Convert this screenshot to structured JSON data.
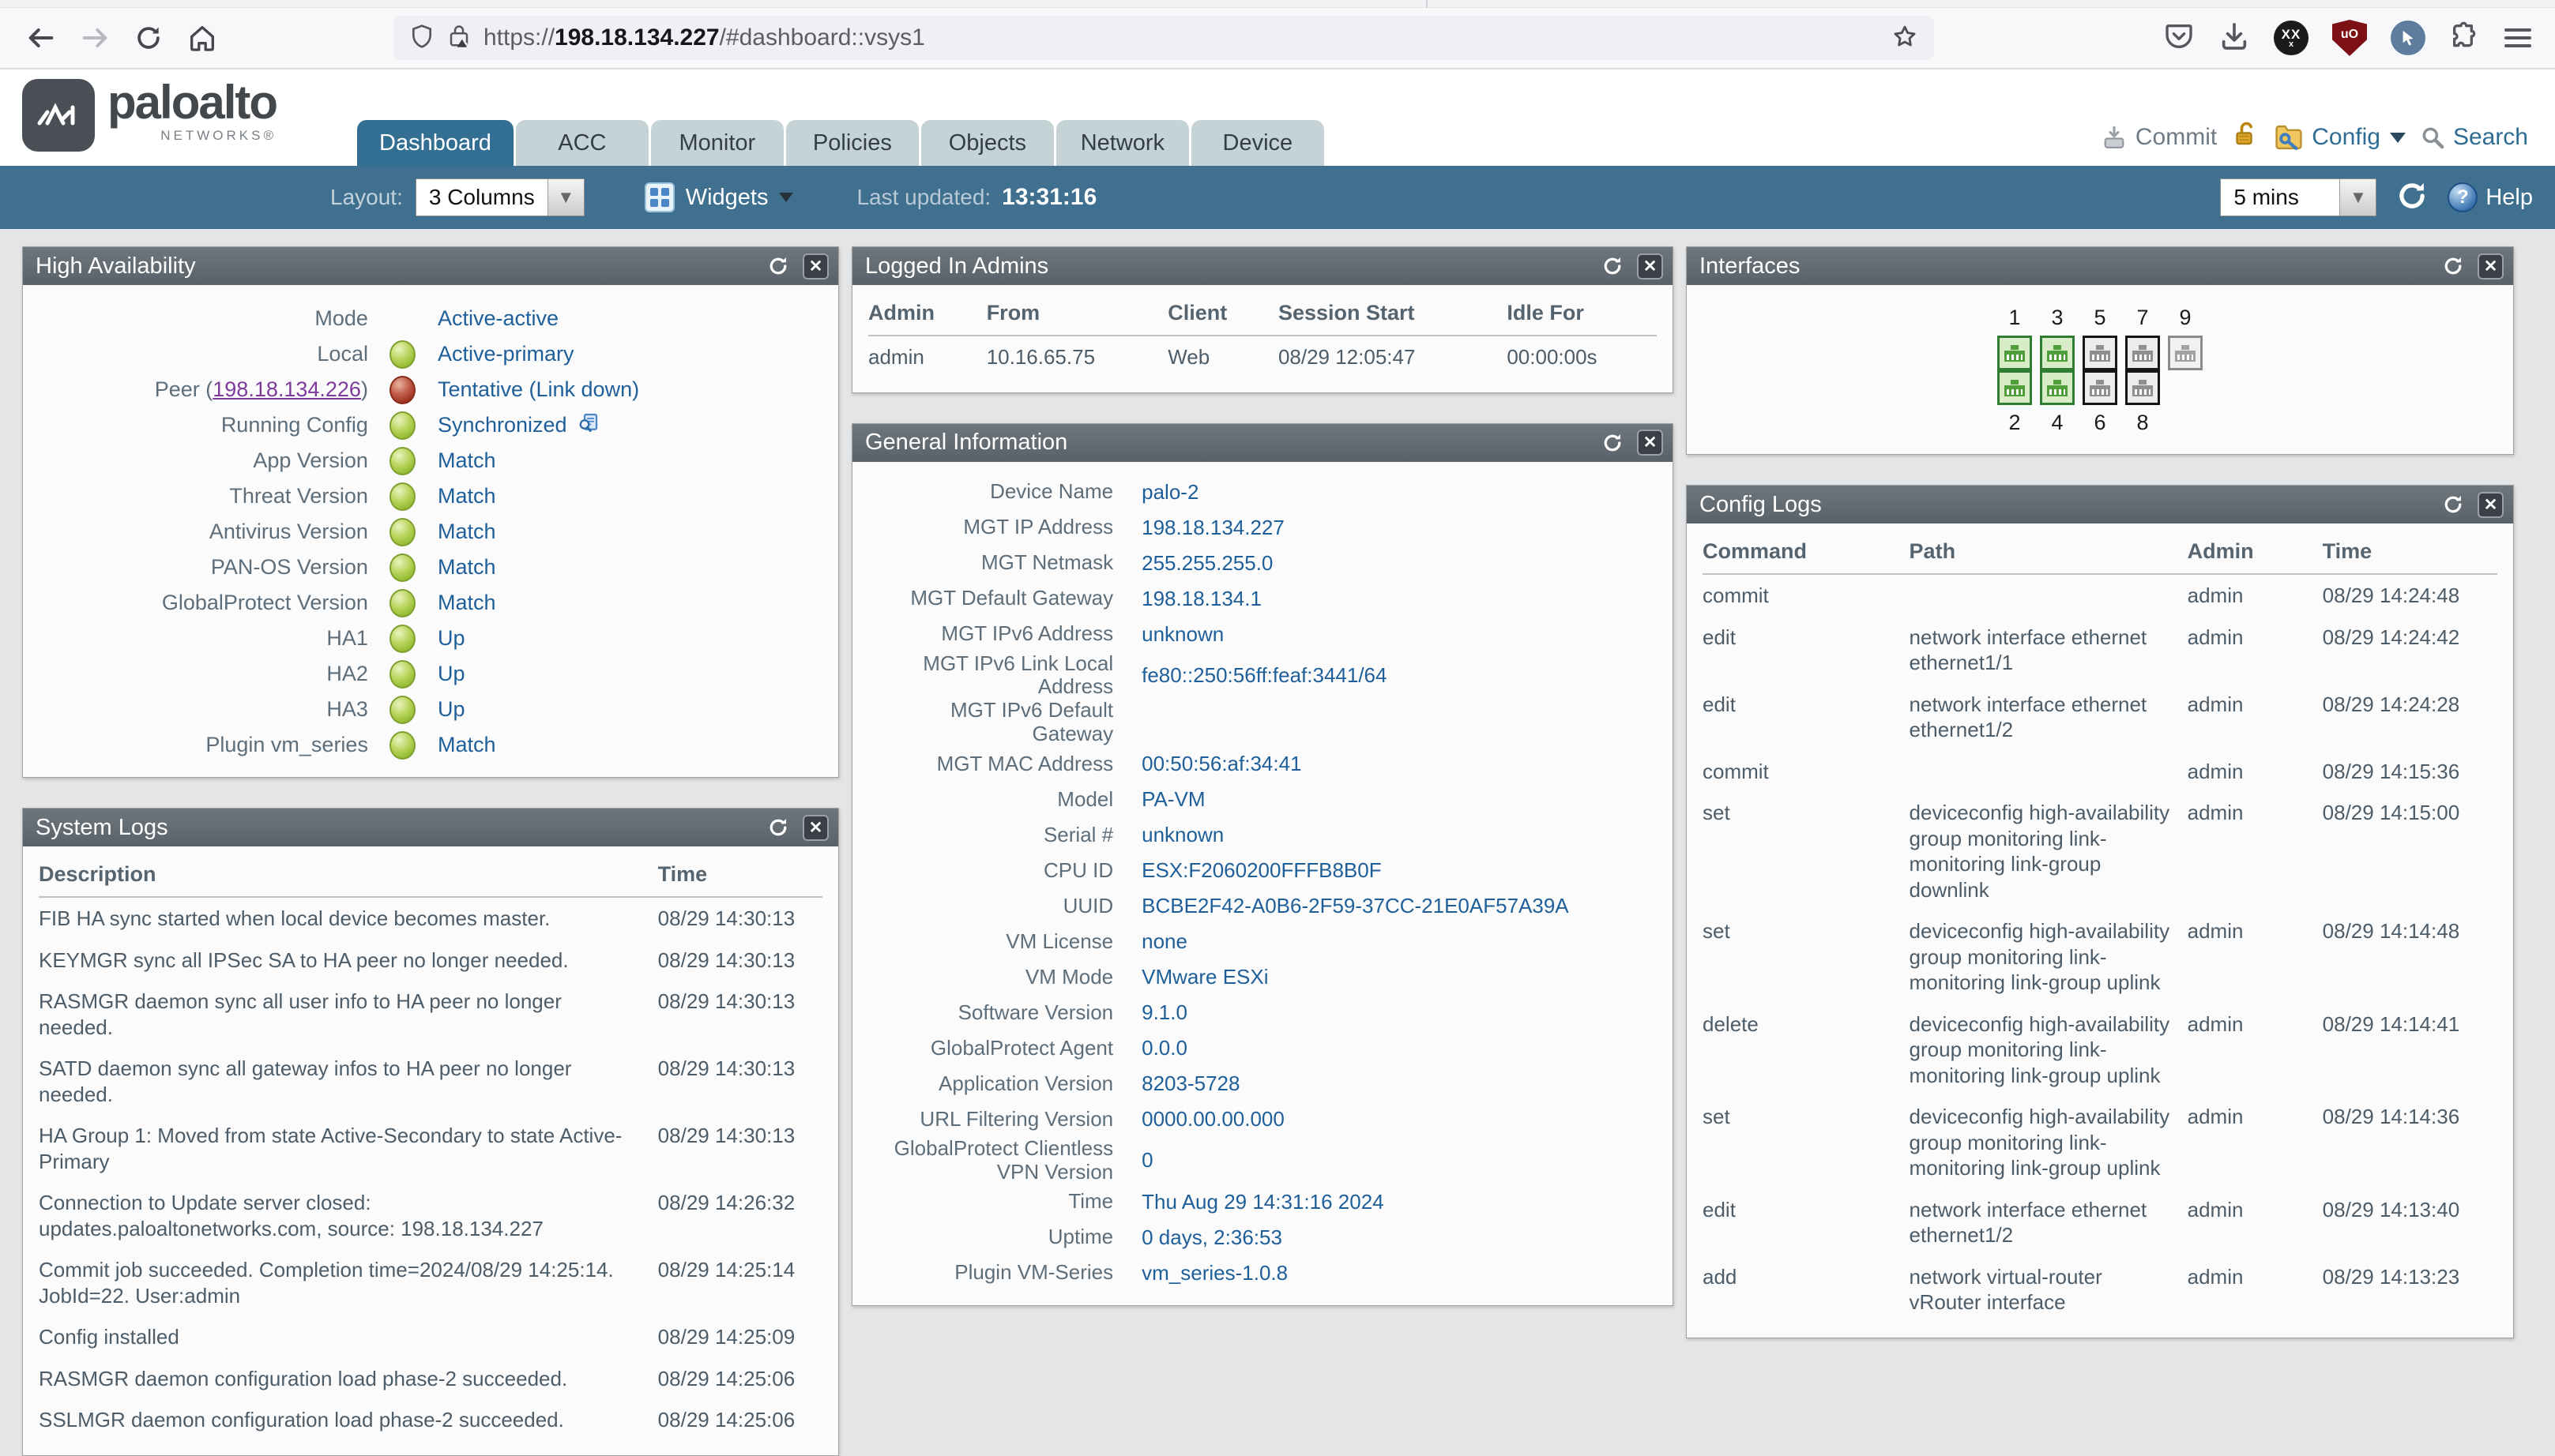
{
  "browser": {
    "url": {
      "prefix": "https://",
      "host": "198.18.134.227",
      "path": "/#dashboard::vsys1"
    },
    "extensions": {
      "xx_label": "XX",
      "xx_small": "x",
      "ublock_label": "uO"
    }
  },
  "header": {
    "brand": {
      "name": "paloalto",
      "sub": "NETWORKS®"
    },
    "tabs": [
      {
        "label": "Dashboard",
        "cls": "active"
      },
      {
        "label": "ACC",
        "cls": ""
      },
      {
        "label": "Monitor",
        "cls": ""
      },
      {
        "label": "Policies",
        "cls": ""
      },
      {
        "label": "Objects",
        "cls": ""
      },
      {
        "label": "Network",
        "cls": ""
      },
      {
        "label": "Device",
        "cls": ""
      }
    ],
    "actions": {
      "commit": "Commit",
      "config": "Config",
      "search": "Search"
    }
  },
  "toolbar": {
    "layout_label": "Layout:",
    "layout_value": "3 Columns",
    "widgets_label": "Widgets",
    "last_updated_label": "Last updated:",
    "last_updated_value": "13:31:16",
    "refresh_interval": "5 mins",
    "help_label": "Help"
  },
  "icons": {
    "close": "✕",
    "dropdown": "▼",
    "help": "?"
  },
  "widgets": {
    "high_availability": {
      "title": "High Availability",
      "rows": [
        {
          "label": "Mode",
          "value": "Active-active"
        },
        {
          "label": "Local",
          "led": "green",
          "value": "Active-primary"
        },
        {
          "label": "Peer (",
          "link": "198.18.134.226",
          "suffix": ")",
          "led": "red",
          "value": "Tentative (Link down)"
        },
        {
          "label": "Running Config",
          "led": "green",
          "value": "Synchronized",
          "value_icon": "sync-preview"
        },
        {
          "label": "App Version",
          "led": "green",
          "value": "Match"
        },
        {
          "label": "Threat Version",
          "led": "green",
          "value": "Match"
        },
        {
          "label": "Antivirus Version",
          "led": "green",
          "value": "Match"
        },
        {
          "label": "PAN-OS Version",
          "led": "green",
          "value": "Match"
        },
        {
          "label": "GlobalProtect Version",
          "led": "green",
          "value": "Match"
        },
        {
          "label": "HA1",
          "led": "green",
          "value": "Up"
        },
        {
          "label": "HA2",
          "led": "green",
          "value": "Up"
        },
        {
          "label": "HA3",
          "led": "green",
          "value": "Up"
        },
        {
          "label": "Plugin vm_series",
          "led": "green",
          "value": "Match"
        }
      ]
    },
    "system_logs": {
      "title": "System Logs",
      "columns": [
        "Description",
        "Time"
      ],
      "rows": [
        {
          "description": "FIB HA sync started when local device becomes master.",
          "time": "08/29 14:30:13"
        },
        {
          "description": "KEYMGR sync all IPSec SA to HA peer no longer needed.",
          "time": "08/29 14:30:13"
        },
        {
          "description": "RASMGR daemon sync all user info to HA peer no longer needed.",
          "time": "08/29 14:30:13"
        },
        {
          "description": "SATD daemon sync all gateway infos to HA peer no longer needed.",
          "time": "08/29 14:30:13"
        },
        {
          "description": "HA Group 1: Moved from state Active-Secondary to state Active-Primary",
          "time": "08/29 14:30:13"
        },
        {
          "description": "Connection to Update server closed: updates.paloaltonetworks.com, source: 198.18.134.227",
          "time": "08/29 14:26:32"
        },
        {
          "description": "Commit job succeeded. Completion time=2024/08/29 14:25:14. JobId=22. User:admin",
          "time": "08/29 14:25:14"
        },
        {
          "description": "Config installed",
          "time": "08/29 14:25:09"
        },
        {
          "description": "RASMGR daemon configuration load phase-2 succeeded.",
          "time": "08/29 14:25:06"
        },
        {
          "description": "SSLMGR daemon configuration load phase-2 succeeded.",
          "time": "08/29 14:25:06"
        }
      ]
    },
    "logged_in_admins": {
      "title": "Logged In Admins",
      "columns": [
        "Admin",
        "From",
        "Client",
        "Session Start",
        "Idle For"
      ],
      "rows": [
        {
          "admin": "admin",
          "from": "10.16.65.75",
          "client": "Web",
          "session_start": "08/29 12:05:47",
          "idle_for": "00:00:00s"
        }
      ]
    },
    "general_information": {
      "title": "General Information",
      "rows": [
        {
          "label": "Device Name",
          "value": "palo-2"
        },
        {
          "label": "MGT IP Address",
          "value": "198.18.134.227"
        },
        {
          "label": "MGT Netmask",
          "value": "255.255.255.0"
        },
        {
          "label": "MGT Default Gateway",
          "value": "198.18.134.1"
        },
        {
          "label": "MGT IPv6 Address",
          "value": "unknown"
        },
        {
          "label": "MGT IPv6 Link Local Address",
          "value": "fe80::250:56ff:feaf:3441/64"
        },
        {
          "label": "MGT IPv6 Default Gateway",
          "value": ""
        },
        {
          "label": "MGT MAC Address",
          "value": "00:50:56:af:34:41"
        },
        {
          "label": "Model",
          "value": "PA-VM"
        },
        {
          "label": "Serial #",
          "value": "unknown"
        },
        {
          "label": "CPU ID",
          "value": "ESX:F2060200FFFB8B0F"
        },
        {
          "label": "UUID",
          "value": "BCBE2F42-A0B6-2F59-37CC-21E0AF57A39A"
        },
        {
          "label": "VM License",
          "value": "none"
        },
        {
          "label": "VM Mode",
          "value": "VMware ESXi"
        },
        {
          "label": "Software Version",
          "value": "9.1.0"
        },
        {
          "label": "GlobalProtect Agent",
          "value": "0.0.0"
        },
        {
          "label": "Application Version",
          "value": "8203-5728"
        },
        {
          "label": "URL Filtering Version",
          "value": "0000.00.00.000"
        },
        {
          "label": "GlobalProtect Clientless VPN Version",
          "value": "0"
        },
        {
          "label": "Time",
          "value": "Thu Aug 29 14:31:16 2024"
        },
        {
          "label": "Uptime",
          "value": "0 days, 2:36:53"
        },
        {
          "label": "Plugin VM-Series",
          "value": "vm_series-1.0.8"
        }
      ]
    },
    "interfaces": {
      "title": "Interfaces",
      "top_ports": [
        {
          "num": "1",
          "state": "up"
        },
        {
          "num": "3",
          "state": "up"
        },
        {
          "num": "5",
          "state": "down"
        },
        {
          "num": "7",
          "state": "down"
        },
        {
          "num": "9",
          "state": "unused"
        }
      ],
      "bottom_ports": [
        {
          "num": "2",
          "state": "up"
        },
        {
          "num": "4",
          "state": "up"
        },
        {
          "num": "6",
          "state": "down"
        },
        {
          "num": "8",
          "state": "down"
        }
      ]
    },
    "config_logs": {
      "title": "Config Logs",
      "columns": [
        "Command",
        "Path",
        "Admin",
        "Time"
      ],
      "rows": [
        {
          "command": "commit",
          "path": "",
          "admin": "admin",
          "time": "08/29 14:24:48"
        },
        {
          "command": "edit",
          "path": "network interface ethernet ethernet1/1",
          "admin": "admin",
          "time": "08/29 14:24:42"
        },
        {
          "command": "edit",
          "path": "network interface ethernet ethernet1/2",
          "admin": "admin",
          "time": "08/29 14:24:28"
        },
        {
          "command": "commit",
          "path": "",
          "admin": "admin",
          "time": "08/29 14:15:36"
        },
        {
          "command": "set",
          "path": "deviceconfig high-availability group monitoring link-monitoring link-group downlink",
          "admin": "admin",
          "time": "08/29 14:15:00"
        },
        {
          "command": "set",
          "path": "deviceconfig high-availability group monitoring link-monitoring link-group uplink",
          "admin": "admin",
          "time": "08/29 14:14:48"
        },
        {
          "command": "delete",
          "path": "deviceconfig high-availability group monitoring link-monitoring link-group uplink",
          "admin": "admin",
          "time": "08/29 14:14:41"
        },
        {
          "command": "set",
          "path": "deviceconfig high-availability group monitoring link-monitoring link-group uplink",
          "admin": "admin",
          "time": "08/29 14:14:36"
        },
        {
          "command": "edit",
          "path": "network interface ethernet ethernet1/2",
          "admin": "admin",
          "time": "08/29 14:13:40"
        },
        {
          "command": "add",
          "path": "network virtual-router vRouter interface",
          "admin": "admin",
          "time": "08/29 14:13:23"
        }
      ]
    }
  },
  "colors": {
    "accent_blue": "#1e5f99",
    "visited_link_purple": "#7d3a9b",
    "led_green": "#9fc33b",
    "led_red": "#a93326",
    "top_bar_blue": "#3f7090",
    "active_tab_blue": "#336f92",
    "inactive_tab_gray": "#c6d3d6",
    "widget_header_gray": "#60696f",
    "port_up_green": "#4f9e3a",
    "ublock_red": "#7c1014"
  }
}
